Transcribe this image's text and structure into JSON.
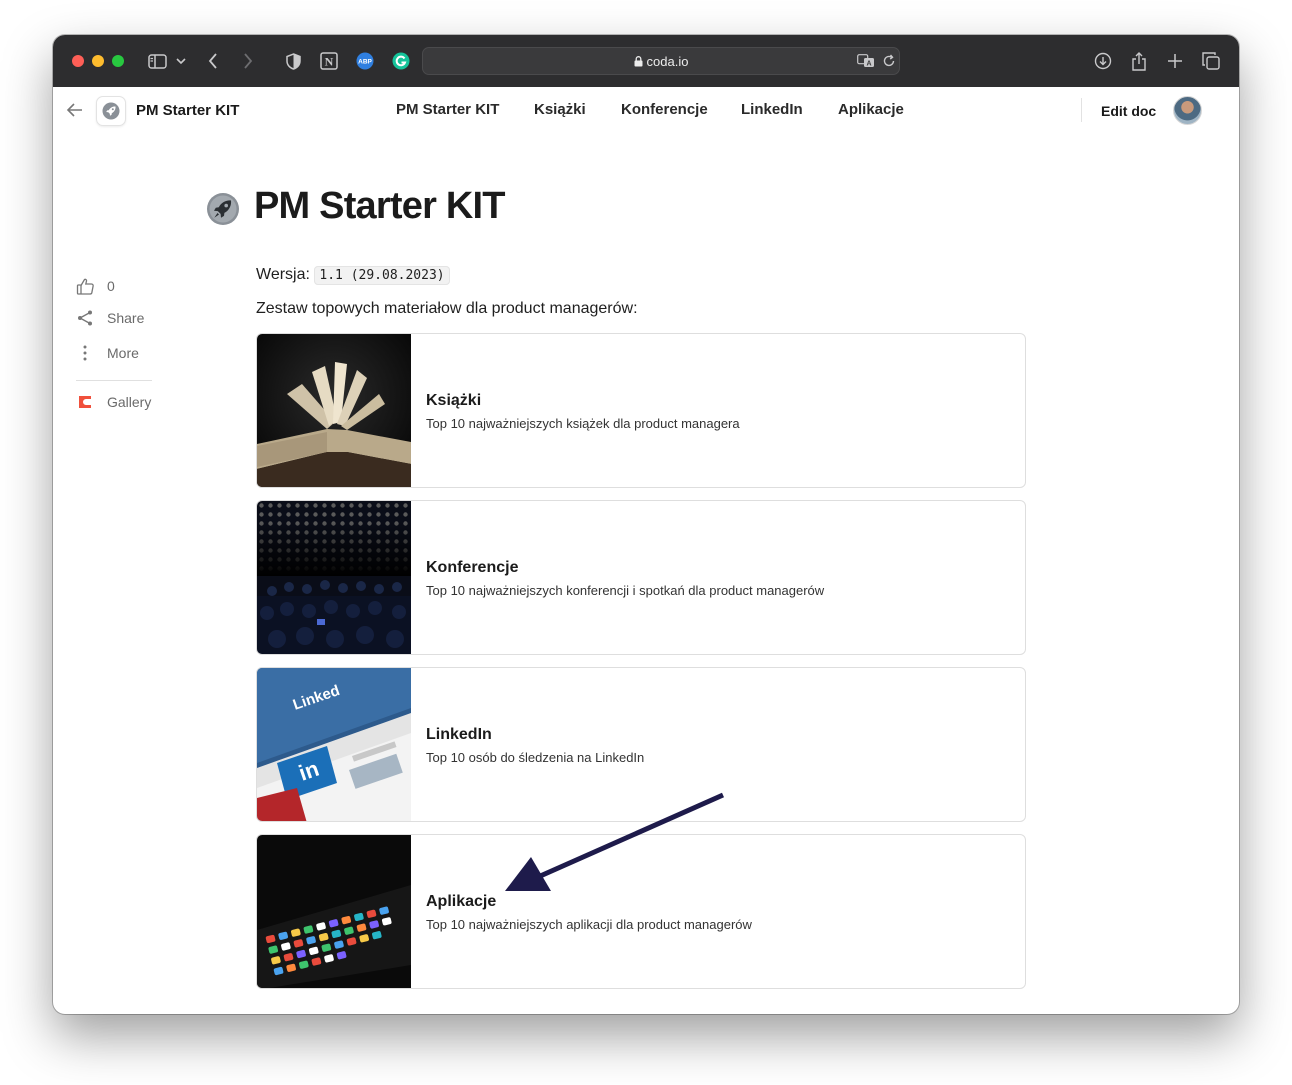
{
  "browser": {
    "url": "coda.io"
  },
  "header": {
    "doc_title": "PM Starter KIT",
    "tabs": [
      {
        "label": "PM Starter KIT"
      },
      {
        "label": "Książki"
      },
      {
        "label": "Konferencje"
      },
      {
        "label": "LinkedIn"
      },
      {
        "label": "Aplikacje"
      }
    ],
    "edit_label": "Edit doc"
  },
  "rail": {
    "likes_count": "0",
    "share_label": "Share",
    "more_label": "More",
    "gallery_label": "Gallery"
  },
  "page": {
    "title": "PM Starter KIT",
    "version_label": "Wersja:",
    "version_value": "1.1 (29.08.2023)",
    "intro": "Zestaw topowych materiałow dla product managerów:"
  },
  "cards": [
    {
      "title": "Książki",
      "desc": "Top 10 najważniejszych książek dla product managera"
    },
    {
      "title": "Konferencje",
      "desc": "Top 10 najważniejszych konferencji i spotkań dla product managerów"
    },
    {
      "title": "LinkedIn",
      "desc": "Top 10 osób do śledzenia na LinkedIn"
    },
    {
      "title": "Aplikacje",
      "desc": "Top 10 najważniejszych aplikacji dla product managerów"
    }
  ],
  "colors": {
    "titlebar": "#2d2d2f",
    "gallery_accent": "#f0503c",
    "annotation_arrow": "#1e1b4b"
  }
}
